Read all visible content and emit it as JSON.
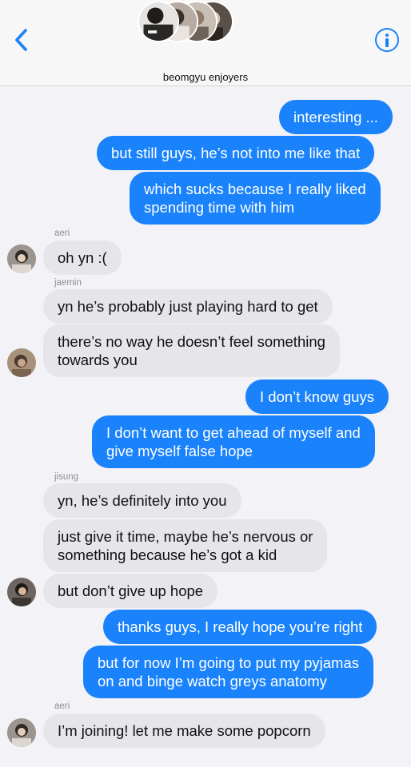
{
  "header": {
    "group_name": "beomgyu enjoyers"
  },
  "senders": {
    "aeri": "aeri",
    "jaemin": "jaemin",
    "jisung": "jisung"
  },
  "messages": [
    "interesting ...",
    "but still guys, he’s not into me like that",
    "which sucks because I really liked\nspending time with him",
    "oh yn :(",
    "yn he’s probably just playing hard to get",
    "there’s no way he doesn’t feel something\ntowards you",
    "I don’t know guys",
    "I don’t want to get ahead of myself and\ngive myself false hope",
    "yn, he’s definitely into you",
    "just give it time, maybe he’s nervous or\nsomething because he’s got a kid",
    "but don’t give up hope",
    "thanks guys, I really hope you’re right",
    "but for now I’m going to put my pyjamas\non and binge watch greys anatomy",
    "I’m joining! let me make some popcorn"
  ],
  "colors": {
    "outgoing_bubble": "#1a82fb",
    "incoming_bubble": "#e5e5ea",
    "thread_background": "#f2f2f7",
    "accent": "#1a82fb"
  },
  "icons": {
    "back": "chevron-left-icon",
    "info": "info-icon"
  }
}
